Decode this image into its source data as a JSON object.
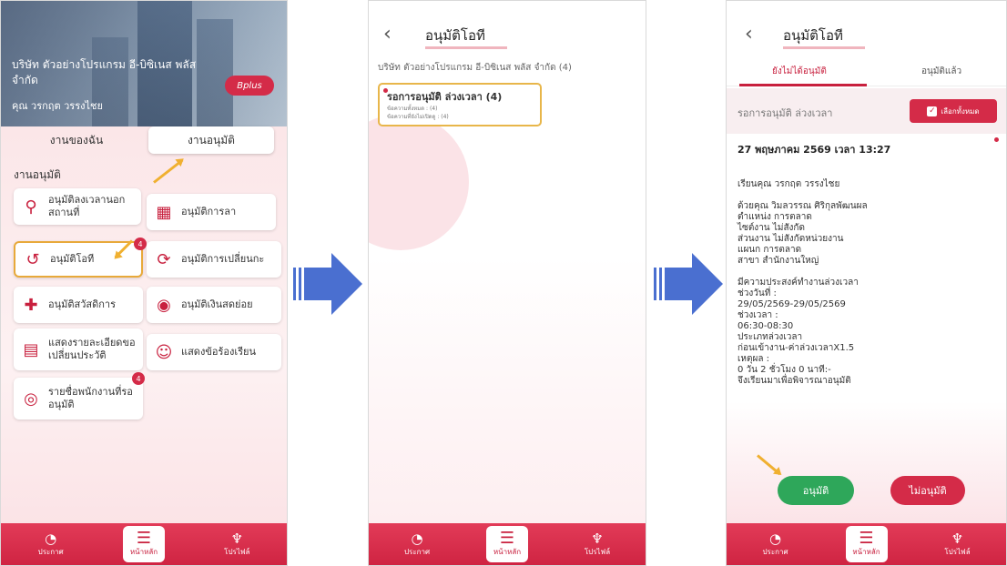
{
  "nav": {
    "news": "ประกาศ",
    "home": "หน้าหลัก",
    "profile": "โปรไฟล์"
  },
  "screen1": {
    "company": "บริษัท ตัวอย่างโปรแกรม อี-บิซิเนส พลัส จำกัด",
    "user": "คุณ วรกฤต วรรงไชย",
    "logo": "Bplus",
    "tab_mine": "งานของฉัน",
    "tab_approve": "งานอนุมัติ",
    "section": "งานอนุมัติ",
    "items": [
      {
        "label": "อนุมัติลงเวลานอกสถานที่",
        "icon": "map-pin-route-icon"
      },
      {
        "label": "อนุมัติการลา",
        "icon": "calendar-icon"
      },
      {
        "label": "อนุมัติโอที",
        "icon": "clock-refresh-icon",
        "badge": "4"
      },
      {
        "label": "อนุมัติการเปลี่ยนกะ",
        "icon": "sync-icon"
      },
      {
        "label": "อนุมัติสวัสดิการ",
        "icon": "hand-plus-icon"
      },
      {
        "label": "อนุมัติเงินสดย่อย",
        "icon": "hand-coin-icon"
      },
      {
        "label": "แสดงรายละเอียดขอเปลี่ยนประวัติ",
        "icon": "document-icon"
      },
      {
        "label": "แสดงข้อร้องเรียน",
        "icon": "smiley-icon"
      },
      {
        "label": "รายชื่อพนักงานที่รออนุมัติ",
        "icon": "target-pin-icon",
        "badge": "4"
      }
    ]
  },
  "screen2": {
    "title": "อนุมัติโอที",
    "subtitle": "บริษัท ตัวอย่างโปรแกรม อี-บิซิเนส พลัส จำกัด (4)",
    "card_title": "รอการอนุมัติ ล่วงเวลา (4)",
    "card_total": "ข้อความทั้งหมด : (4)",
    "card_unread": "ข้อความที่ยังไม่เปิดดู : (4)"
  },
  "screen3": {
    "title": "อนุมัติโอที",
    "tab_pending": "ยังไม่ได้อนุมัติ",
    "tab_done": "อนุมัติแล้ว",
    "filter_label": "รอการอนุมัติ ล่วงเวลา",
    "select_all": "เลือกทั้งหมด",
    "date": "27 พฤษภาคม 2569 เวลา 13:27",
    "greeting": "เรียนคุณ วรกฤต วรรงไชย",
    "lines1": [
      "ด้วยคุณ วิมลวรรณ ศิริกุลพัฒนผล",
      "ตำแหน่ง การตลาด",
      "ไซต์งาน ไม่สังกัด",
      "ส่วนงาน ไม่สังกัดหน่วยงาน",
      "แผนก การตลาด",
      "สาขา สำนักงานใหญ่"
    ],
    "lines2": [
      "มีความประสงค์ทำงานล่วงเวลา",
      "ช่วงวันที่ :",
      "29/05/2569-29/05/2569",
      "ช่วงเวลา :",
      "06:30-08:30",
      "ประเภทล่วงเวลา",
      "ก่อนเข้างาน-ค่าล่วงเวลาX1.5",
      "เหตุผล :",
      "0 วัน 2 ชั่วโมง 0 นาที:-",
      "จึงเรียนมาเพื่อพิจารณาอนุมัติ"
    ],
    "approve": "อนุมัติ",
    "reject": "ไม่อนุมัติ"
  },
  "colors": {
    "brand": "#d42b48",
    "approve": "#2ea75a",
    "highlight": "#e8a93a",
    "arrow": "#4a6fd0"
  }
}
